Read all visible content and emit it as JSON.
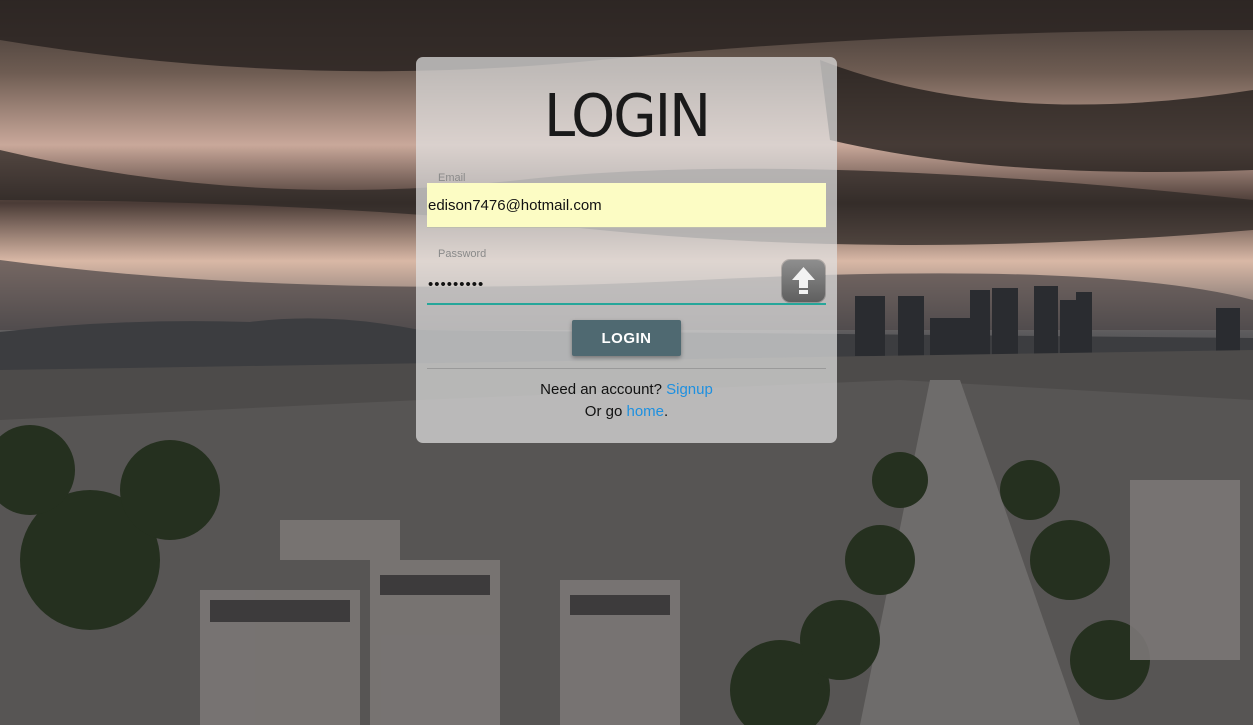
{
  "login": {
    "title": "LOGIN",
    "email_label": "Email",
    "email_value": "edison7476@hotmail.com",
    "password_label": "Password",
    "password_value": "•••••••••",
    "submit_label": "LOGIN",
    "account_prompt": "Need an account?",
    "signup_link": "Signup",
    "go_prefix": "Or go",
    "home_link": "home",
    "go_suffix": "."
  },
  "icons": {
    "password_manager": "upload-arrow-icon"
  },
  "colors": {
    "accent": "#26a69a",
    "button": "#4f6971",
    "link": "#1e90e0",
    "autofill": "#fcfcc4"
  }
}
